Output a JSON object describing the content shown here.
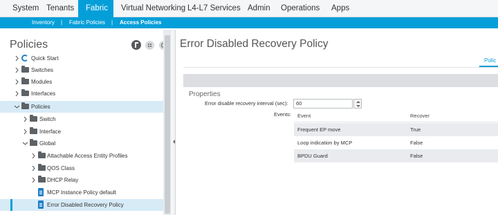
{
  "topnav": {
    "tabs": [
      "System",
      "Tenants",
      "Fabric",
      "Virtual Networking",
      "L4-L7 Services",
      "Admin",
      "Operations",
      "Apps"
    ],
    "active_index": 2,
    "accent_color": "#049fd9"
  },
  "subnav": {
    "items": [
      "Inventory",
      "Fabric Policies",
      "Access Policies"
    ],
    "separator": "|",
    "active_index": 2
  },
  "left": {
    "title": "Policies",
    "header_icons": [
      "account-circle-icon",
      "settings-grid-icon",
      "gear-icon"
    ],
    "tree": [
      {
        "label": "Quick Start",
        "icon": "quick-start-icon",
        "expanded": false
      },
      {
        "label": "Switches",
        "icon": "folder-icon",
        "expanded": false
      },
      {
        "label": "Modules",
        "icon": "folder-icon",
        "expanded": false
      },
      {
        "label": "Interfaces",
        "icon": "folder-icon",
        "expanded": false
      },
      {
        "label": "Policies",
        "icon": "folder-icon",
        "expanded": true
      },
      {
        "label": "Switch",
        "icon": "folder-icon",
        "expanded": false
      },
      {
        "label": "Interface",
        "icon": "folder-icon",
        "expanded": false
      },
      {
        "label": "Global",
        "icon": "folder-icon",
        "expanded": true
      },
      {
        "label": "Attachable Access Entity Profiles",
        "icon": "folder-icon",
        "expanded": false
      },
      {
        "label": "QOS Class",
        "icon": "folder-icon",
        "expanded": false
      },
      {
        "label": "DHCP Relay",
        "icon": "folder-icon",
        "expanded": false
      },
      {
        "label": "MCP Instance Policy default",
        "icon": "policy-doc-icon"
      },
      {
        "label": "Error Disabled Recovery Policy",
        "icon": "policy-doc-icon",
        "selected": true
      }
    ]
  },
  "right": {
    "title": "Error Disabled Recovery Policy",
    "tab_label": "Polic",
    "properties_title": "Properties",
    "interval_label": "Error disable recovery interval (sec):",
    "interval_value": "60",
    "events_label": "Events:",
    "events_table": {
      "headers": [
        "Event",
        "Recover"
      ],
      "rows": [
        [
          "Frequent EP move",
          "True"
        ],
        [
          "Loop indication by MCP",
          "False"
        ],
        [
          "BPDU Guard",
          "False"
        ]
      ]
    }
  }
}
